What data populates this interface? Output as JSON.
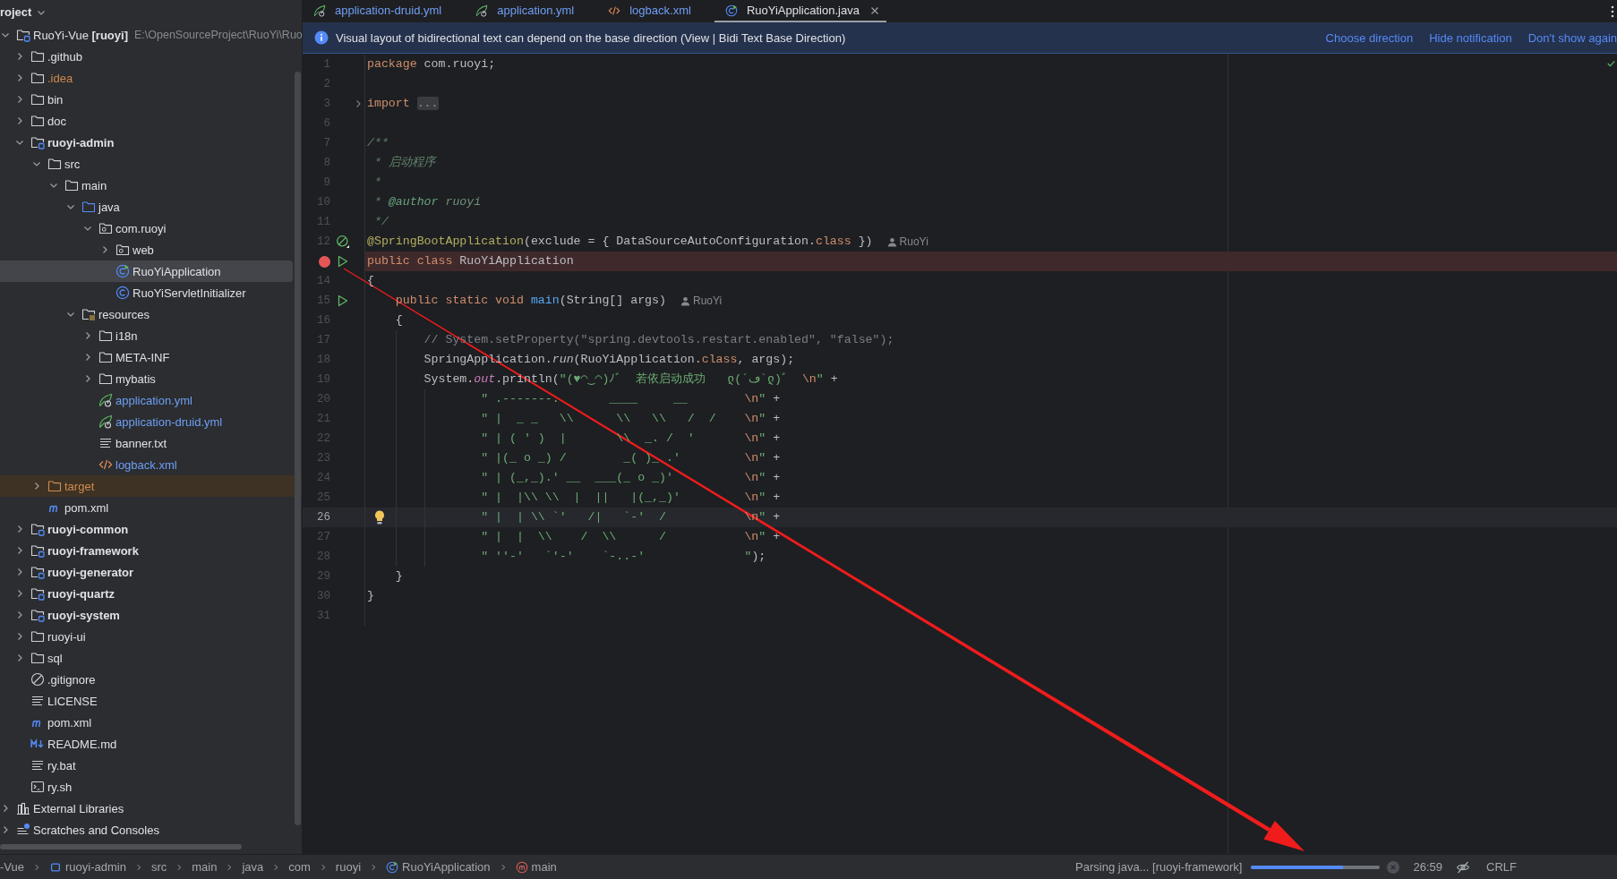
{
  "project": {
    "title": "roject",
    "tree": [
      {
        "label": "RuoYi-Vue **[ruoyi]**",
        "path": "E:\\OpenSourceProject\\RuoYi\\Ruo",
        "kind": "project",
        "expanded": true,
        "selected": false,
        "children": [
          {
            "label": ".github",
            "kind": "folder",
            "expanded": false,
            "selected": false
          },
          {
            "label": ".idea",
            "kind": "folder",
            "color": "#d08a50",
            "expanded": false,
            "selected": false
          },
          {
            "label": "bin",
            "kind": "folder",
            "expanded": false,
            "selected": false
          },
          {
            "label": "doc",
            "kind": "folder",
            "expanded": false,
            "selected": false
          },
          {
            "label": "ruoyi-admin",
            "kind": "module",
            "expanded": true,
            "selected": false,
            "children": [
              {
                "label": "src",
                "kind": "folder",
                "expanded": true,
                "selected": false,
                "children": [
                  {
                    "label": "main",
                    "kind": "folder",
                    "expanded": true,
                    "selected": false,
                    "children": [
                      {
                        "label": "java",
                        "kind": "source-folder",
                        "expanded": true,
                        "selected": false,
                        "children": [
                          {
                            "label": "com.ruoyi",
                            "kind": "package",
                            "expanded": true,
                            "selected": false,
                            "children": [
                              {
                                "label": "web",
                                "kind": "package",
                                "expanded": false,
                                "selected": false
                              },
                              {
                                "label": "RuoYiApplication",
                                "kind": "class-run",
                                "selected": true
                              },
                              {
                                "label": "RuoYiServletInitializer",
                                "kind": "class",
                                "selected": false
                              }
                            ]
                          }
                        ]
                      },
                      {
                        "label": "resources",
                        "kind": "resources",
                        "expanded": true,
                        "selected": false,
                        "children": [
                          {
                            "label": "i18n",
                            "kind": "folder",
                            "expanded": false,
                            "selected": false
                          },
                          {
                            "label": "META-INF",
                            "kind": "folder",
                            "expanded": false,
                            "selected": false
                          },
                          {
                            "label": "mybatis",
                            "kind": "folder",
                            "expanded": false,
                            "selected": false
                          },
                          {
                            "label": "application.yml",
                            "kind": "spring-yml",
                            "color": "#6f9ff5",
                            "selected": false
                          },
                          {
                            "label": "application-druid.yml",
                            "kind": "spring-yml",
                            "color": "#6f9ff5",
                            "selected": false
                          },
                          {
                            "label": "banner.txt",
                            "kind": "text",
                            "selected": false
                          },
                          {
                            "label": "logback.xml",
                            "kind": "xml",
                            "color": "#6f9ff5",
                            "selected": false
                          }
                        ]
                      }
                    ]
                  }
                ]
              },
              {
                "label": "target",
                "kind": "excluded-folder",
                "color": "#d08a50",
                "expanded": false,
                "selected": false
              },
              {
                "label": "pom.xml",
                "kind": "maven",
                "selected": false
              }
            ]
          },
          {
            "label": "ruoyi-common",
            "kind": "module",
            "expanded": false,
            "selected": false
          },
          {
            "label": "ruoyi-framework",
            "kind": "module",
            "expanded": false,
            "selected": false
          },
          {
            "label": "ruoyi-generator",
            "kind": "module",
            "expanded": false,
            "selected": false
          },
          {
            "label": "ruoyi-quartz",
            "kind": "module",
            "expanded": false,
            "selected": false
          },
          {
            "label": "ruoyi-system",
            "kind": "module",
            "expanded": false,
            "selected": false
          },
          {
            "label": "ruoyi-ui",
            "kind": "folder",
            "expanded": false,
            "selected": false
          },
          {
            "label": "sql",
            "kind": "folder",
            "expanded": false,
            "selected": false
          },
          {
            "label": ".gitignore",
            "kind": "gitignore",
            "selected": false
          },
          {
            "label": "LICENSE",
            "kind": "text",
            "selected": false
          },
          {
            "label": "pom.xml",
            "kind": "maven",
            "selected": false
          },
          {
            "label": "README.md",
            "kind": "markdown",
            "selected": false
          },
          {
            "label": "ry.bat",
            "kind": "text",
            "selected": false
          },
          {
            "label": "ry.sh",
            "kind": "shell",
            "selected": false
          }
        ]
      },
      {
        "label": "External Libraries",
        "kind": "libraries",
        "expanded": false,
        "selected": false
      },
      {
        "label": "Scratches and Consoles",
        "kind": "scratches",
        "expanded": false,
        "selected": false
      }
    ]
  },
  "editor": {
    "tabs": [
      {
        "label": "application-druid.yml",
        "kind": "spring-yml",
        "color": "#6f9ff5",
        "selected": false
      },
      {
        "label": "application.yml",
        "kind": "spring-yml",
        "color": "#6f9ff5",
        "selected": false
      },
      {
        "label": "logback.xml",
        "kind": "xml",
        "color": "#6f9ff5",
        "selected": false
      },
      {
        "label": "RuoYiApplication.java",
        "kind": "class-run",
        "selected": true
      }
    ],
    "notification": {
      "text": "Visual layout of bidirectional text can depend on the base direction (View | Bidi Text Base Direction)",
      "actions": [
        "Choose direction",
        "Hide notification",
        "Don't show again"
      ]
    },
    "lines": [
      {
        "number": "1",
        "breakpoint": false,
        "current": false,
        "tokens": [
          {
            "kind": "kw",
            "text": "package"
          },
          {
            "kind": "plain",
            "text": " com.ruoyi;"
          }
        ]
      },
      {
        "number": "2",
        "breakpoint": false,
        "current": false
      },
      {
        "number": "3",
        "breakpoint": false,
        "current": false,
        "gutter": [
          {
            "kind": "fold"
          }
        ],
        "tokens": [
          {
            "kind": "kw",
            "text": "import "
          },
          {
            "kind": "folded",
            "text": "..."
          }
        ]
      },
      {
        "number": "6",
        "breakpoint": false,
        "current": false
      },
      {
        "number": "7",
        "breakpoint": false,
        "current": false,
        "tokens": [
          {
            "kind": "doc",
            "text": "/**"
          }
        ]
      },
      {
        "number": "8",
        "breakpoint": false,
        "current": false,
        "tokens": [
          {
            "kind": "doc",
            "text": " * 启动程序"
          }
        ]
      },
      {
        "number": "9",
        "breakpoint": false,
        "current": false,
        "tokens": [
          {
            "kind": "doc",
            "text": " *"
          }
        ]
      },
      {
        "number": "10",
        "breakpoint": false,
        "current": false,
        "tokens": [
          {
            "kind": "doc",
            "text": " * "
          },
          {
            "kind": "doc-tag",
            "text": "@author"
          },
          {
            "kind": "doc-value",
            "text": " ruoyi"
          }
        ]
      },
      {
        "number": "11",
        "breakpoint": false,
        "current": false,
        "tokens": [
          {
            "kind": "doc",
            "text": " */"
          }
        ]
      },
      {
        "number": "12",
        "breakpoint": false,
        "current": false,
        "gutter": [
          {
            "kind": "spring"
          }
        ],
        "tokens": [
          {
            "kind": "annotation",
            "text": "@SpringBootApplication"
          },
          {
            "kind": "plain",
            "text": "(exclude = { DataSourceAutoConfiguration."
          },
          {
            "kind": "kw",
            "text": "class"
          },
          {
            "kind": "plain",
            "text": " })"
          },
          {
            "kind": "hint",
            "text": "RuoYi"
          }
        ]
      },
      {
        "breakpoint": true,
        "current": false,
        "gutter": [
          {
            "kind": "run"
          }
        ],
        "tokens": [
          {
            "kind": "kw",
            "text": "public class"
          },
          {
            "kind": "plain",
            "text": " RuoYiApplication"
          }
        ]
      },
      {
        "number": "14",
        "breakpoint": false,
        "current": false,
        "tokens": [
          {
            "kind": "plain",
            "text": "{"
          }
        ]
      },
      {
        "number": "15",
        "breakpoint": false,
        "current": false,
        "gutter": [
          {
            "kind": "run"
          }
        ],
        "tokens": [
          {
            "kind": "kw",
            "text": "    public static void "
          },
          {
            "kind": "method-decl",
            "text": "main"
          },
          {
            "kind": "plain",
            "text": "(String[] args)"
          },
          {
            "kind": "hint",
            "text": "RuoYi"
          }
        ]
      },
      {
        "number": "16",
        "breakpoint": false,
        "current": false,
        "tokens": [
          {
            "kind": "plain",
            "text": "    {"
          }
        ]
      },
      {
        "number": "17",
        "breakpoint": false,
        "current": false,
        "tokens": [
          {
            "kind": "comment",
            "text": "        // System.setProperty(\"spring.devtools.restart.enabled\", \"false\");"
          }
        ]
      },
      {
        "number": "18",
        "breakpoint": false,
        "current": false,
        "tokens": [
          {
            "kind": "plain",
            "text": "        SpringApplication."
          },
          {
            "kind": "static-call",
            "text": "run"
          },
          {
            "kind": "plain",
            "text": "(RuoYiApplication."
          },
          {
            "kind": "kw",
            "text": "class"
          },
          {
            "kind": "plain",
            "text": ", args);"
          }
        ]
      },
      {
        "number": "19",
        "breakpoint": false,
        "current": false,
        "tokens": [
          {
            "kind": "plain",
            "text": "        System."
          },
          {
            "kind": "static-field",
            "text": "out"
          },
          {
            "kind": "plain",
            "text": ".println("
          },
          {
            "kind": "string",
            "text": "\"(♥◠‿◠)ﾉﾞ  若依启动成功   ლ(´ڡ`ლ)ﾞ  "
          },
          {
            "kind": "escape",
            "text": "\\n"
          },
          {
            "kind": "string",
            "text": "\""
          },
          {
            "kind": "plain",
            "text": " +"
          }
        ]
      },
      {
        "number": "20",
        "breakpoint": false,
        "current": false,
        "tokens": [
          {
            "kind": "string",
            "text": "                \" .-------.       ____     __        "
          },
          {
            "kind": "escape",
            "text": "\\n"
          },
          {
            "kind": "string",
            "text": "\""
          },
          {
            "kind": "plain",
            "text": " +"
          }
        ]
      },
      {
        "number": "21",
        "breakpoint": false,
        "current": false,
        "tokens": [
          {
            "kind": "string",
            "text": "                \" |  _ _   \\\\      \\\\   \\\\   /  /    "
          },
          {
            "kind": "escape",
            "text": "\\n"
          },
          {
            "kind": "string",
            "text": "\""
          },
          {
            "kind": "plain",
            "text": " +"
          }
        ]
      },
      {
        "number": "22",
        "breakpoint": false,
        "current": false,
        "tokens": [
          {
            "kind": "string",
            "text": "                \" | ( ' )  |       \\\\  _. /  '       "
          },
          {
            "kind": "escape",
            "text": "\\n"
          },
          {
            "kind": "string",
            "text": "\""
          },
          {
            "kind": "plain",
            "text": " +"
          }
        ]
      },
      {
        "number": "23",
        "breakpoint": false,
        "current": false,
        "tokens": [
          {
            "kind": "string",
            "text": "                \" |(_ o _) /        _( )_ .'         "
          },
          {
            "kind": "escape",
            "text": "\\n"
          },
          {
            "kind": "string",
            "text": "\""
          },
          {
            "kind": "plain",
            "text": " +"
          }
        ]
      },
      {
        "number": "24",
        "breakpoint": false,
        "current": false,
        "tokens": [
          {
            "kind": "string",
            "text": "                \" | (_,_).' __  ___(_ o _)'          "
          },
          {
            "kind": "escape",
            "text": "\\n"
          },
          {
            "kind": "string",
            "text": "\""
          },
          {
            "kind": "plain",
            "text": " +"
          }
        ]
      },
      {
        "number": "25",
        "breakpoint": false,
        "current": false,
        "tokens": [
          {
            "kind": "string",
            "text": "                \" |  |\\\\ \\\\  |  ||   |(_,_)'         "
          },
          {
            "kind": "escape",
            "text": "\\n"
          },
          {
            "kind": "string",
            "text": "\""
          },
          {
            "kind": "plain",
            "text": " +"
          }
        ]
      },
      {
        "number": "26",
        "breakpoint": false,
        "current": true,
        "gutter": [
          {
            "kind": "bulb"
          }
        ],
        "tokens": [
          {
            "kind": "string",
            "text": "                \" |  | \\\\ `'   /|   `-'  /           "
          },
          {
            "kind": "escape",
            "text": "\\n"
          },
          {
            "kind": "string",
            "text": "\""
          },
          {
            "kind": "plain",
            "text": " +"
          }
        ]
      },
      {
        "number": "27",
        "breakpoint": false,
        "current": false,
        "tokens": [
          {
            "kind": "string",
            "text": "                \" |  |  \\\\    /  \\\\      /           "
          },
          {
            "kind": "escape",
            "text": "\\n"
          },
          {
            "kind": "string",
            "text": "\""
          },
          {
            "kind": "plain",
            "text": " +"
          }
        ]
      },
      {
        "number": "28",
        "breakpoint": false,
        "current": false,
        "tokens": [
          {
            "kind": "string",
            "text": "                \" ''-'   `'-'    `-..-'              \""
          },
          {
            "kind": "plain",
            "text": ");"
          }
        ]
      },
      {
        "number": "29",
        "breakpoint": false,
        "current": false,
        "tokens": [
          {
            "kind": "plain",
            "text": "    }"
          }
        ]
      },
      {
        "number": "30",
        "breakpoint": false,
        "current": false,
        "tokens": [
          {
            "kind": "plain",
            "text": "}"
          }
        ]
      },
      {
        "number": "31",
        "breakpoint": false,
        "current": false
      }
    ]
  },
  "status_bar": {
    "breadcrumbs": [
      {
        "label": "-Vue",
        "kind": "plain"
      },
      {
        "label": "ruoyi-admin",
        "kind": "module-mark"
      },
      {
        "label": "src",
        "kind": "plain"
      },
      {
        "label": "main",
        "kind": "plain"
      },
      {
        "label": "java",
        "kind": "plain"
      },
      {
        "label": "com",
        "kind": "plain"
      },
      {
        "label": "ruoyi",
        "kind": "plain"
      },
      {
        "label": "RuoYiApplication",
        "kind": "class-run"
      },
      {
        "label": "main",
        "kind": "method"
      }
    ],
    "task": "Parsing java... [ruoyi-framework]",
    "progress": {
      "level": 0.72
    },
    "caret": "26:59",
    "line_separator": "CRLF"
  }
}
